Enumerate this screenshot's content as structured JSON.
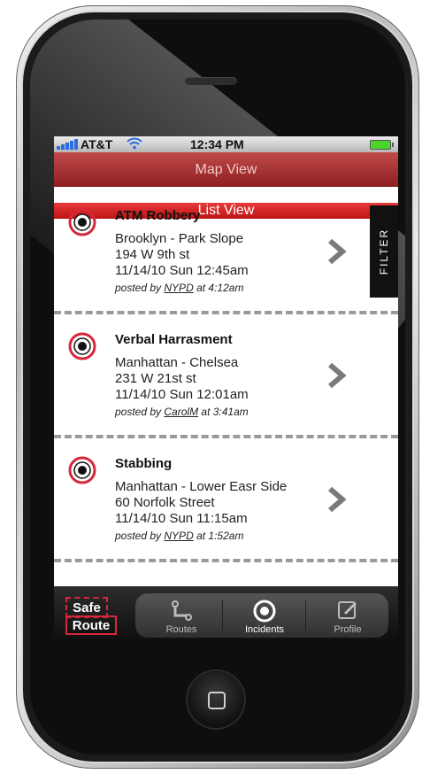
{
  "status_bar": {
    "carrier": "AT&T",
    "time": "12:34 PM"
  },
  "tabs": [
    {
      "label": "Map View",
      "selected": false
    },
    {
      "label": "List View",
      "selected": true
    }
  ],
  "filter": {
    "label": "FILTER"
  },
  "incidents": [
    {
      "title": "ATM Robbery",
      "location": "Brooklyn - Park Slope",
      "address": "194 W 9th st",
      "datetime": "11/14/10 Sun 12:45am",
      "posted_prefix": "posted by",
      "posted_by": "NYPD",
      "posted_at": "at 4:12am"
    },
    {
      "title": "Verbal Harrasment",
      "location": "Manhattan - Chelsea",
      "address": "231 W 21st st",
      "datetime": "11/14/10 Sun 12:01am",
      "posted_prefix": "posted by",
      "posted_by": "CarolM",
      "posted_at": "at 3:41am"
    },
    {
      "title": "Stabbing",
      "location": "Manhattan - Lower Easr Side",
      "address": "60 Norfolk Street",
      "datetime": "11/14/10 Sun 11:15am",
      "posted_prefix": "posted by",
      "posted_by": "NYPD",
      "posted_at": "at 1:52am"
    }
  ],
  "logo": {
    "line1": "Safe",
    "line2": "Route"
  },
  "tabbar": [
    {
      "label": "Routes",
      "icon": "routes-icon",
      "active": false
    },
    {
      "label": "Incidents",
      "icon": "incidents-icon",
      "active": true
    },
    {
      "label": "Profile",
      "icon": "profile-icon",
      "active": false
    }
  ],
  "colors": {
    "accent": "#d7263d",
    "tab_active": "#e02a2a",
    "signal": "#2b6de0",
    "battery": "#4dd42c"
  }
}
